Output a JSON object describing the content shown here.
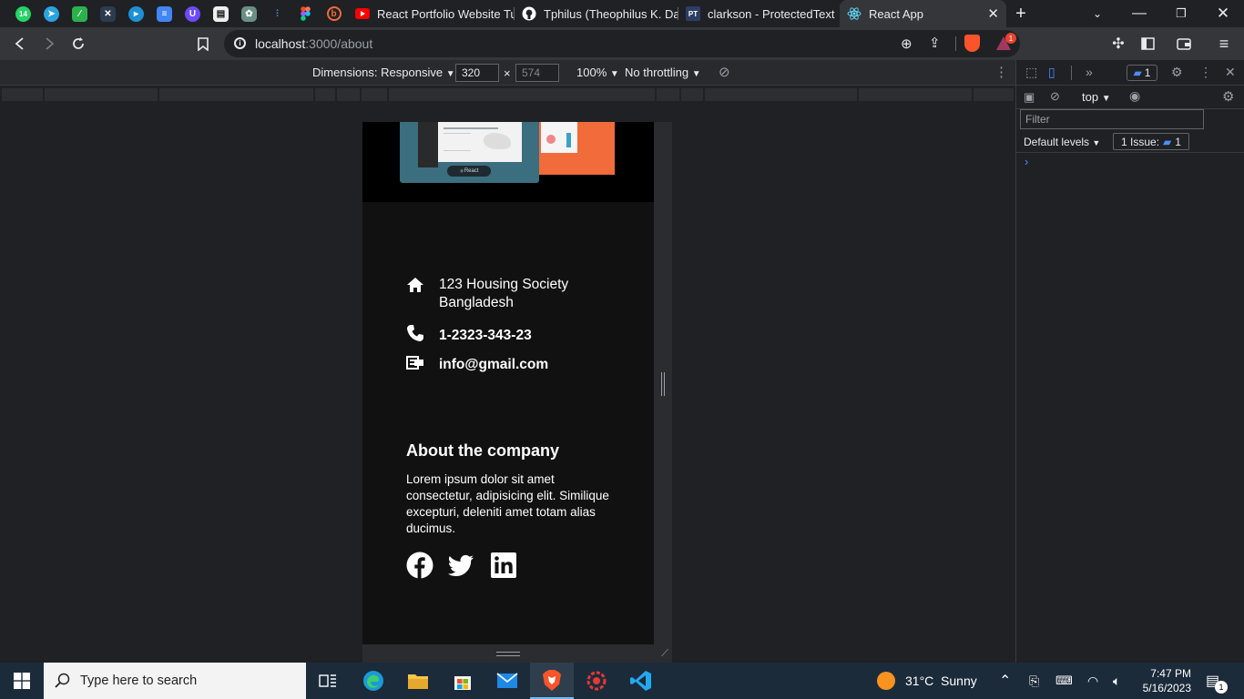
{
  "browser": {
    "tabs": [
      {
        "title": "React Portfolio Website Tut",
        "favicon": "youtube-icon",
        "color": "#ff0000"
      },
      {
        "title": "Tphilus (Theophilus K. Dadz",
        "favicon": "github-icon",
        "color": "#ffffff"
      },
      {
        "title": "clarkson - ProtectedText",
        "favicon": "pt-icon",
        "color": "#1f4e8c"
      },
      {
        "title": "React App",
        "favicon": "react-icon",
        "color": "#61dafb",
        "active": true
      }
    ],
    "pinned_badge": "14",
    "new_tab": "+",
    "url_host": "localhost",
    "url_rest": ":3000/about",
    "brave_badge": "1"
  },
  "device_toolbar": {
    "dimensions_label": "Dimensions: Responsive",
    "width": "320",
    "height": "574",
    "times": "×",
    "zoom": "100%",
    "throttling": "No throttling"
  },
  "page": {
    "hero_pill": "React",
    "address_line1": "123 Housing Society",
    "address_line2": "Bangladesh",
    "phone": "1-2323-343-23",
    "email": "info@gmail.com",
    "about_title": "About the company",
    "about_text": "Lorem ipsum dolor sit amet consectetur, adipisicing elit. Similique excepturi, deleniti amet totam alias ducimus."
  },
  "devtools": {
    "messages_badge": "1",
    "context": "top",
    "filter_placeholder": "Filter",
    "levels": "Default levels",
    "issues_label": "1 Issue:",
    "issues_count": "1",
    "prompt": "›"
  },
  "taskbar": {
    "search_placeholder": "Type here to search",
    "weather": "31°C  Sunny",
    "time": "7:47 PM",
    "date": "5/16/2023",
    "notif_count": "1"
  }
}
